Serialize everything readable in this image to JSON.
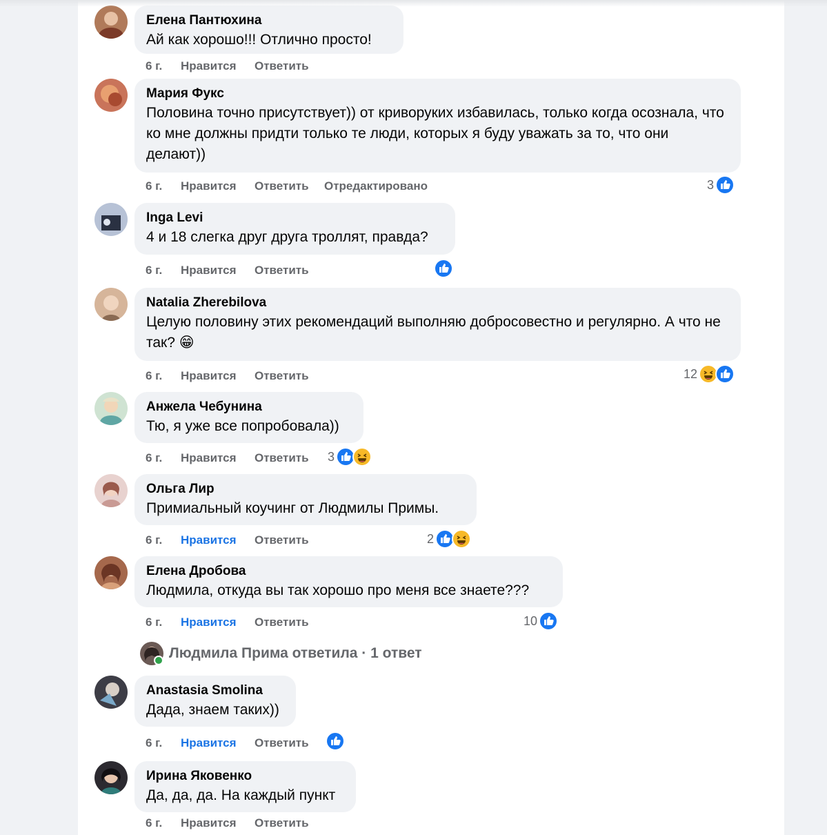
{
  "comments": [
    {
      "author": "Елена Пантюхина",
      "text": "Ай как хорошо!!! Отлично просто!",
      "time": "6 г.",
      "like": "Нравится",
      "reply": "Ответить",
      "avatar_color": "#b07a5a"
    },
    {
      "author": "Мария Фукс",
      "text": "Половина точно присутствует)) от криворуких избавилась, только когда осознала, что ко мне должны придти только те люди, которых я буду уважать за то, что они делают))",
      "time": "6 г.",
      "like": "Нравится",
      "reply": "Ответить",
      "edited": "Отредактировано",
      "reaction_count": "3",
      "reactions": [
        "like"
      ],
      "avatar_color": "#c9745a"
    },
    {
      "author": "Inga Levi",
      "text": "4 и 18 слегка друг друга троллят, правда?",
      "time": "6 г.",
      "like": "Нравится",
      "reply": "Ответить",
      "reactions": [
        "like"
      ],
      "avatar_color": "#7d8aa6"
    },
    {
      "author": "Natalia Zherebilova",
      "text": "Целую половину этих рекомендаций выполняю добросовестно и регулярно. А что не так? 😁",
      "time": "6 г.",
      "like": "Нравится",
      "reply": "Ответить",
      "reaction_count": "12",
      "reactions": [
        "haha",
        "like"
      ],
      "avatar_color": "#d6b59a"
    },
    {
      "author": "Анжела Чебунина",
      "text": "Тю, я уже все попробовала))",
      "time": "6 г.",
      "like": "Нравится",
      "reply": "Ответить",
      "reaction_count": "3",
      "reactions": [
        "like",
        "haha"
      ],
      "avatar_color": "#9dbfa0"
    },
    {
      "author": "Ольга Лир",
      "text": "Примиальный коучинг от Людмилы Примы.",
      "time": "6 г.",
      "like": "Нравится",
      "reply": "Ответить",
      "like_active": true,
      "reaction_count": "2",
      "reactions": [
        "like",
        "haha"
      ],
      "avatar_color": "#c99a94"
    },
    {
      "author": "Елена Дробова",
      "text": "Людмила, откуда вы так хорошо про меня все знаете???",
      "time": "6 г.",
      "like": "Нравится",
      "reply": "Ответить",
      "like_active": true,
      "reaction_count": "10",
      "reactions": [
        "like"
      ],
      "avatar_color": "#a5684c"
    },
    {
      "author": "Anastasia Smolina",
      "text": "Дада, знаем таких))",
      "time": "6 г.",
      "like": "Нравится",
      "reply": "Ответить",
      "like_active": true,
      "reactions": [
        "like"
      ],
      "avatar_color": "#3d3d46"
    },
    {
      "author": "Ирина Яковенко",
      "text": "Да, да, да. На каждый пункт",
      "time": "6 г.",
      "like": "Нравится",
      "reply": "Ответить",
      "avatar_color": "#2c2a30"
    }
  ],
  "reply_summary": {
    "text": "Людмила Прима ответила · 1 ответ",
    "avatar_color": "#6b5a55"
  },
  "colors": {
    "accent": "#1b74e4",
    "like_blue": "#1877f2",
    "haha_yellow": "#f7b928",
    "muted_text": "#65676b",
    "bubble_bg": "#f0f2f5"
  }
}
